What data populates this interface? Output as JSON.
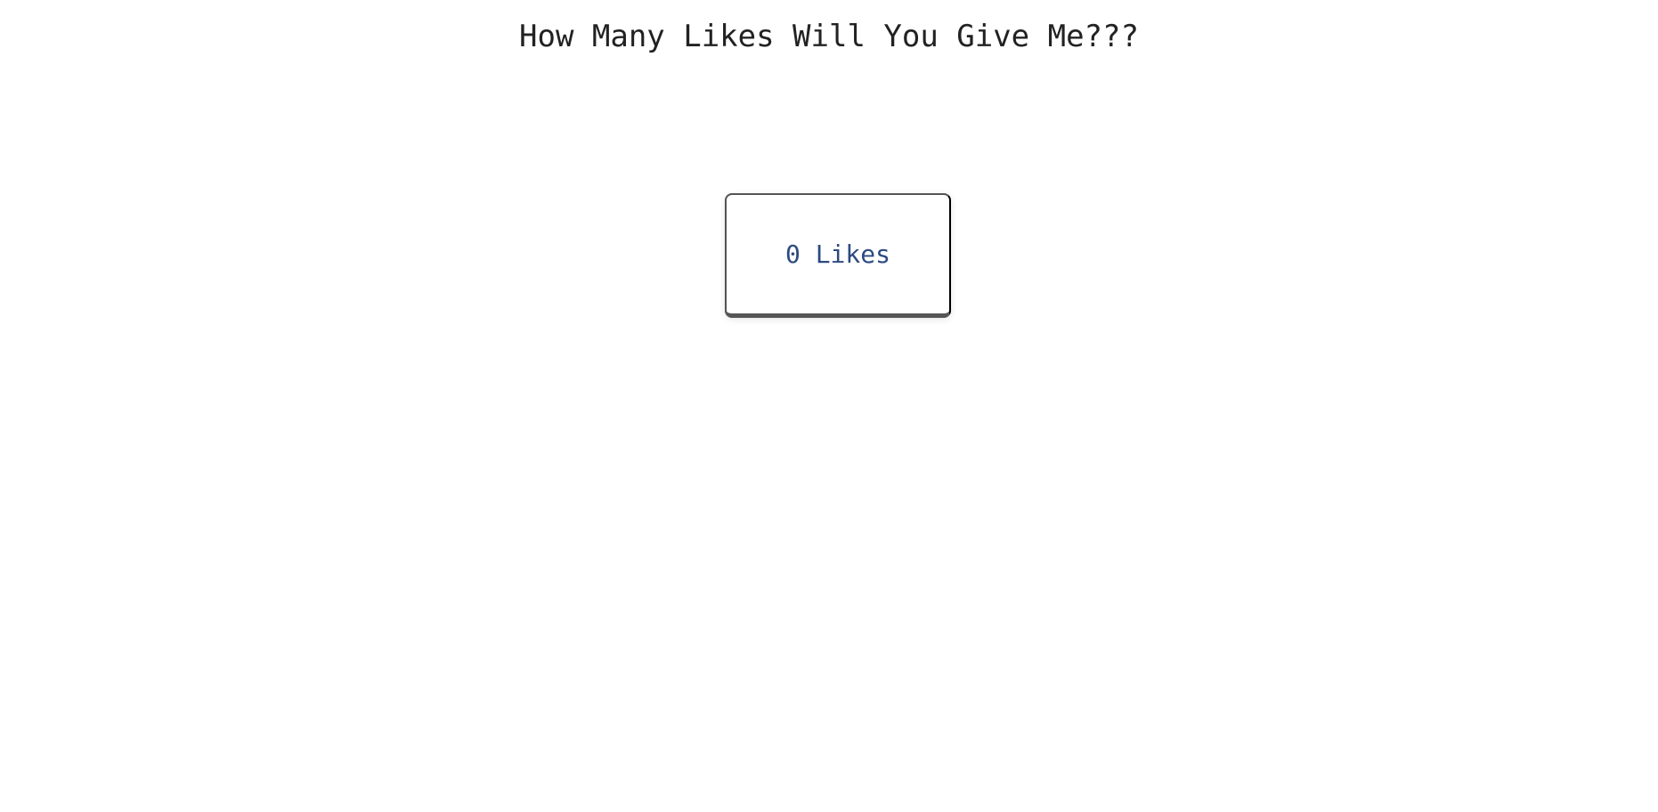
{
  "header": {
    "title": "How Many Likes Will You Give Me???"
  },
  "like_button": {
    "count": "0",
    "unit": "Likes"
  },
  "colors": {
    "title_text": "#222222",
    "like_text": "#2d4a80",
    "card_bottom_border": "#555555",
    "background": "#ffffff"
  }
}
